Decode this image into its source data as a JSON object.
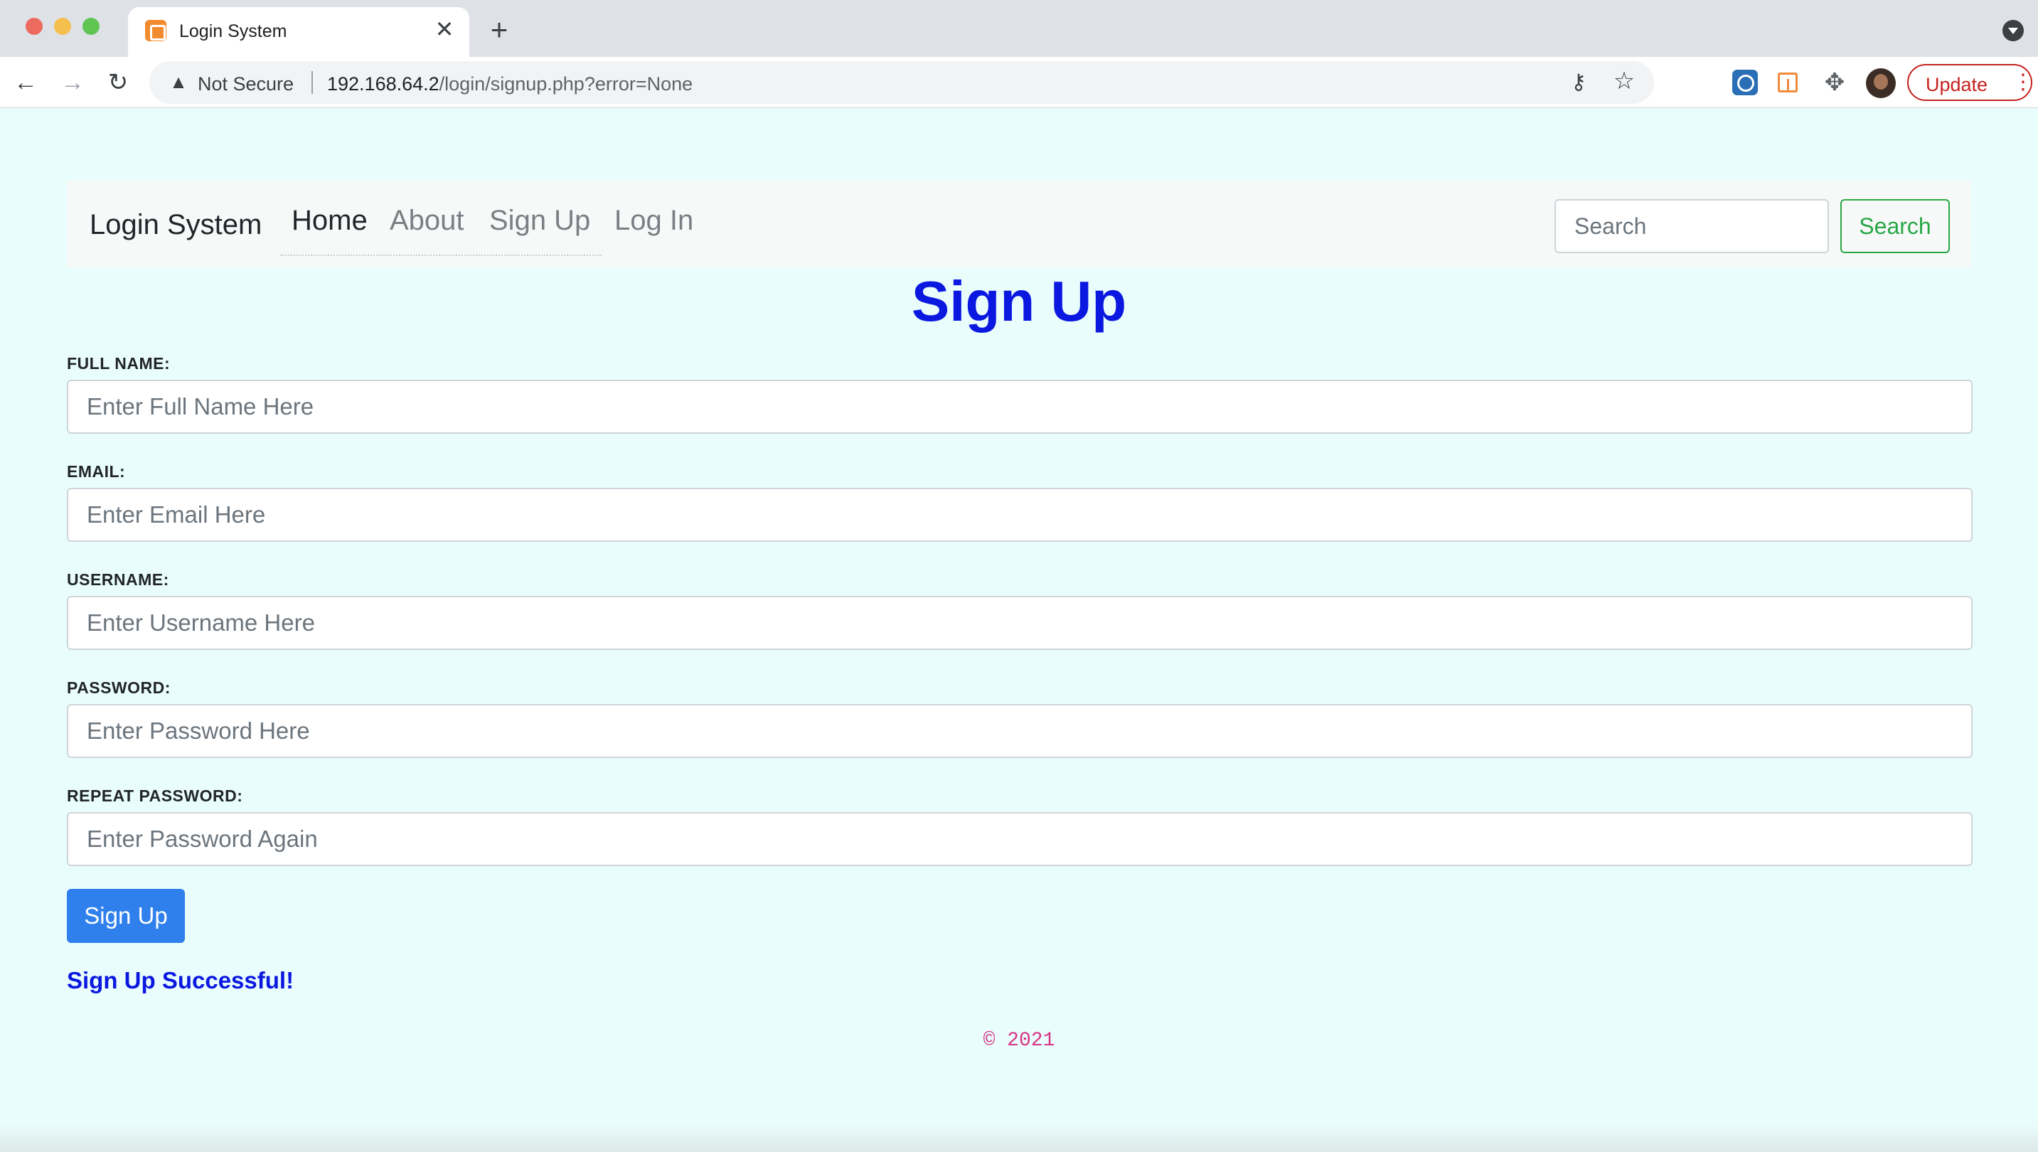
{
  "browser": {
    "tab_title": "Login System",
    "tab_close": "✕",
    "new_tab": "+",
    "security_label": "Not Secure",
    "url_host": "192.168.64.2",
    "url_path": "/login/signup.php?error=None",
    "update_label": "Update",
    "icons": [
      "back-arrow-icon",
      "forward-arrow-icon",
      "reload-icon",
      "warning-icon",
      "key-icon",
      "star-icon",
      "compass-extension-icon",
      "layout-extension-icon",
      "puzzle-icon",
      "avatar",
      "kebab-menu-icon"
    ]
  },
  "navbar": {
    "brand": "Login System",
    "links": [
      "Home",
      "About",
      "Sign Up",
      "Log In"
    ],
    "search_placeholder": "Search",
    "search_button": "Search"
  },
  "form": {
    "title": "Sign Up",
    "fields": [
      {
        "label": "FULL NAME:",
        "placeholder": "Enter Full Name Here"
      },
      {
        "label": "EMAIL:",
        "placeholder": "Enter Email Here"
      },
      {
        "label": "USERNAME:",
        "placeholder": "Enter Username Here"
      },
      {
        "label": "PASSWORD:",
        "placeholder": "Enter Password Here"
      },
      {
        "label": "REPEAT PASSWORD:",
        "placeholder": "Enter Password Again"
      }
    ],
    "submit_label": "Sign Up",
    "success_message": "Sign Up Successful!"
  },
  "footer": {
    "copyright": "© 2021"
  },
  "colors": {
    "page_background": "#eafdfd",
    "title_blue": "#0a18e0",
    "primary_button": "#2f80ed",
    "success_outline": "#28a745",
    "footer_pink": "#d63384",
    "update_red": "#c5221f"
  }
}
